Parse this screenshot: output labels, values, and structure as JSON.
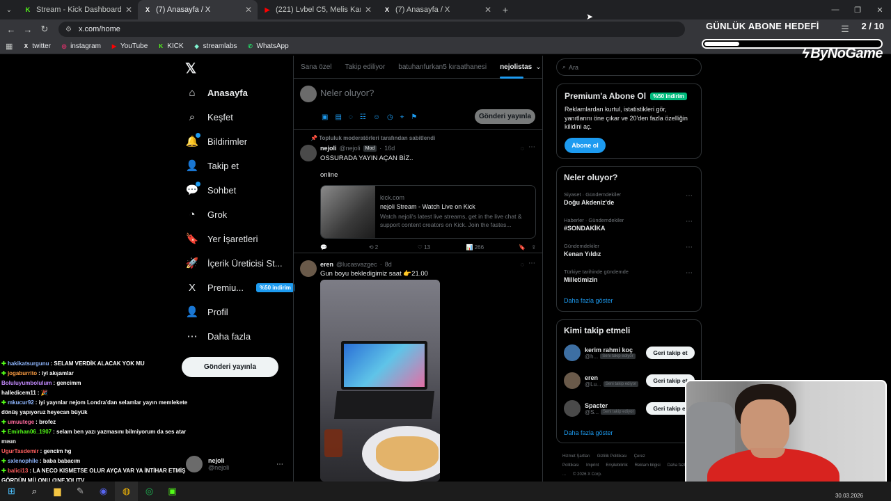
{
  "browser": {
    "tabs": [
      {
        "title": "Stream - Kick Dashboard",
        "favicon": "K",
        "color": "#53fc18",
        "active": false
      },
      {
        "title": "(7) Anasayfa / X",
        "favicon": "X",
        "color": "#ffffff",
        "active": true
      },
      {
        "title": "(221) Lvbel C5, Melis Kar - DAG",
        "favicon": "▶",
        "color": "#ff0000",
        "active": false
      },
      {
        "title": "(7) Anasayfa / X",
        "favicon": "X",
        "color": "#ffffff",
        "active": false
      }
    ],
    "new_tab": "+",
    "url": "x.com/home",
    "bookmarks": [
      {
        "label": "twitter",
        "icon": "X",
        "color": "#ffffff"
      },
      {
        "label": "instagram",
        "icon": "◎",
        "color": "#e1306c"
      },
      {
        "label": "YouTube",
        "icon": "▶",
        "color": "#ff0000"
      },
      {
        "label": "KICK",
        "icon": "K",
        "color": "#53fc18"
      },
      {
        "label": "streamlabs",
        "icon": "◆",
        "color": "#80f5d2"
      },
      {
        "label": "WhatsApp",
        "icon": "✆",
        "color": "#25d366"
      }
    ]
  },
  "overlay": {
    "goal_label": "GÜNLÜK ABONE HEDEFİ",
    "goal_count": "2 / 10",
    "goal_progress": 0.2,
    "brand": "ByNoGame"
  },
  "nav": {
    "items": [
      {
        "label": "Anasayfa",
        "icon": "home-icon",
        "glyph": "⌂",
        "bold": true
      },
      {
        "label": "Keşfet",
        "icon": "search-icon",
        "glyph": "⌕"
      },
      {
        "label": "Bildirimler",
        "icon": "bell-icon",
        "glyph": "🔔",
        "dot": true
      },
      {
        "label": "Takip et",
        "icon": "follow-icon",
        "glyph": "👤"
      },
      {
        "label": "Sohbet",
        "icon": "chat-icon",
        "glyph": "💬",
        "dot": true
      },
      {
        "label": "Grok",
        "icon": "grok-icon",
        "glyph": "◔"
      },
      {
        "label": "Yer İşaretleri",
        "icon": "bookmark-icon",
        "glyph": "🔖"
      },
      {
        "label": "İçerik Üreticisi St...",
        "icon": "rocket-icon",
        "glyph": "🚀"
      },
      {
        "label": "Premiu...",
        "icon": "premium-x-icon",
        "glyph": "X",
        "badge": "%50 indirim"
      },
      {
        "label": "Profil",
        "icon": "profile-icon",
        "glyph": "👤"
      },
      {
        "label": "Daha fazla",
        "icon": "more-icon",
        "glyph": "⋯"
      }
    ],
    "post_button": "Gönderi yayınla",
    "account_name": "nejoli",
    "account_handle": "@nejoli"
  },
  "timeline": {
    "tabs": [
      "Sana özel",
      "Takip ediliyor",
      "batuhanfurkan5 kıraathanesi",
      "nejolistas"
    ],
    "active_tab": "nejolistas",
    "compose_placeholder": "Neler oluyor?",
    "send_button": "Gönderi yayınla",
    "posts": [
      {
        "pinned_note": "Topluluk moderatörleri tarafından sabitlendi",
        "name": "nejoli",
        "handle": "@nejoli",
        "role": "Mod",
        "time": "16d",
        "text1": "OSSURADA YAYIN AÇAN BİZ..",
        "text2": "online",
        "card_domain": "kick.com",
        "card_title": "nejoli Stream - Watch Live on Kick",
        "card_desc": "Watch nejoli's latest live streams, get in the live chat & support content creators on Kick. Join the fastes...",
        "reposts": "2",
        "likes": "13",
        "views": "266"
      },
      {
        "name": "eren",
        "handle": "@lucasvazgec",
        "time": "8d",
        "text1": "Gun boyu bekledigimiz saat 👉21.00"
      }
    ]
  },
  "sidebar": {
    "search_placeholder": "Ara",
    "premium": {
      "title": "Premium'a Abone Ol",
      "badge": "%50 indirim",
      "desc": "Reklamlardan kurtul, istatistikleri gör, yanıtlarını öne çıkar ve 20'den fazla özelliğin kilidini aç.",
      "button": "Abone ol"
    },
    "trends_title": "Neler oluyor?",
    "trends": [
      {
        "cat": "Siyaset · Gündemdekiler",
        "name": "Doğu Akdeniz'de"
      },
      {
        "cat": "Haberler · Gündemdekiler",
        "name": "#SONDAKİKA"
      },
      {
        "cat": "Gündemdekiler",
        "name": "Kenan Yıldız"
      },
      {
        "cat": "Türkiye tarihinde gündemde",
        "name": "Milletimizin"
      }
    ],
    "trends_more": "Daha fazla göster",
    "who_title": "Kimi takip etmeli",
    "who": [
      {
        "name": "kerim rahmi koç",
        "handle": "@h...",
        "tag": "Seni takip ediyor",
        "button": "Geri takip et"
      },
      {
        "name": "eren",
        "handle": "@Lu...",
        "tag": "Seni takip ediyor",
        "button": "Geri takip et"
      },
      {
        "name": "Spacter",
        "handle": "@S...",
        "tag": "Seni takip ediyor",
        "button": "Geri takip et"
      }
    ],
    "who_more": "Daha fazla göster",
    "footer": [
      "Hizmet Şartları",
      "Gizlilik Politikası",
      "Çerez Politikası",
      "Imprint",
      "Erişilebilirlik",
      "Reklam bilgisi",
      "Daha fazla ...",
      "© 2026 X Corp."
    ]
  },
  "chat": [
    {
      "user": "hakikatsurgunu",
      "color": "#8fb7ff",
      "msg": "SELAM VERDİK ALACAK YOK MU",
      "badge": true
    },
    {
      "user": "jogaburrito",
      "color": "#ff9f43",
      "msg": "iyi akşamlar",
      "badge": true
    },
    {
      "user": "Boluluyumbolulum",
      "color": "#c48bff",
      "msg": "gencimm",
      "badge": false
    },
    {
      "user": "halledicem11",
      "color": "#ffffff",
      "msg": "🎉",
      "badge": false
    },
    {
      "user": "mkucur92",
      "color": "#8fb7ff",
      "msg": "iyi yayınlar nejom Londra'dan selamlar yayın memlekete dönüş yapıyoruz heyecan büyük",
      "badge": true
    },
    {
      "user": "umuutege",
      "color": "#ff6b9d",
      "msg": "brofez",
      "badge": true
    },
    {
      "user": "Emirhan06_1907",
      "color": "#53fc18",
      "msg": "selam ben yazı yazmasını bilmiyorum da ses atar mısın",
      "badge": true
    },
    {
      "user": "UgurTasdemir",
      "color": "#ff5f5f",
      "msg": "gencim hg",
      "badge": false
    },
    {
      "user": "sxlenophile",
      "color": "#8fb7ff",
      "msg": "baba babacım",
      "badge": true
    },
    {
      "user": "balici13",
      "color": "#ff5f5f",
      "msg": "LA NECO KISMETSE OLUR AYÇA VAR YA İNTİHAR ETMİŞ GÖRDÜN MÜ ONU @NEJOLITV",
      "badge": true
    }
  ],
  "taskbar": {
    "date": "30.03.2026"
  }
}
